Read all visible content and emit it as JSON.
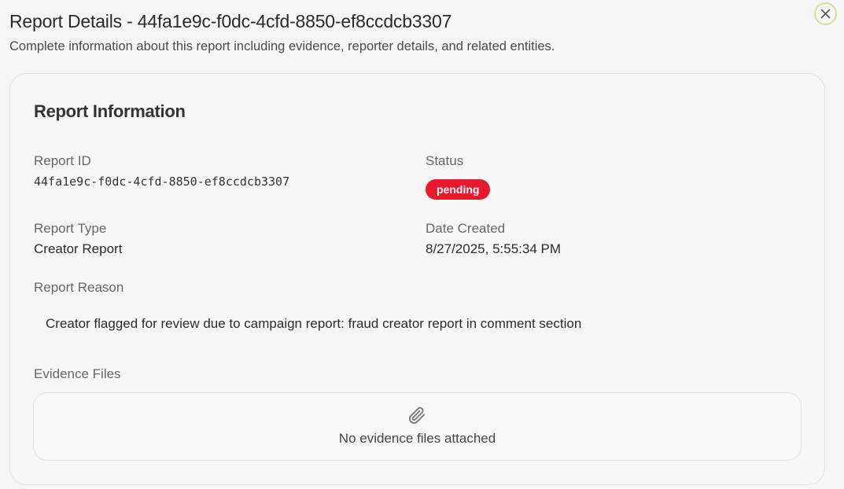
{
  "dialog": {
    "title": "Report Details - 44fa1e9c-f0dc-4cfd-8850-ef8ccdcb3307",
    "subtitle": "Complete information about this report including evidence, reporter details, and related entities.",
    "close_icon": "close-icon"
  },
  "report_info": {
    "heading": "Report Information",
    "report_id_label": "Report ID",
    "report_id_value": "44fa1e9c-f0dc-4cfd-8850-ef8ccdcb3307",
    "status_label": "Status",
    "status_value": "pending",
    "report_type_label": "Report Type",
    "report_type_value": "Creator Report",
    "date_created_label": "Date Created",
    "date_created_value": "8/27/2025, 5:55:34 PM",
    "reason_label": "Report Reason",
    "reason_value": "Creator flagged for review due to campaign report: fraud creator report in comment section",
    "evidence_label": "Evidence Files",
    "evidence_empty": "No evidence files attached",
    "evidence_icon": "paperclip-icon"
  },
  "colors": {
    "status_pending": "#e8192c",
    "close_border": "#cfe39a"
  }
}
